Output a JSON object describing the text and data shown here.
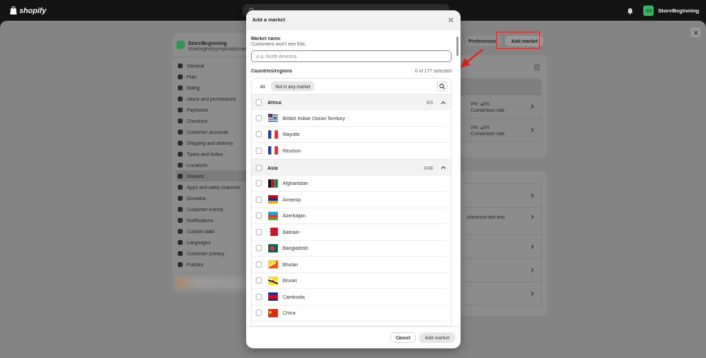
{
  "top_bar": {
    "logo": "shopify",
    "store_initials": "SB",
    "store_name": "StoreBeginning"
  },
  "settings": {
    "store_name": "StoreBeginning",
    "store_url": "storebeginning.myshopify.com",
    "nav": [
      {
        "label": "General",
        "selected": false
      },
      {
        "label": "Plan",
        "selected": false
      },
      {
        "label": "Billing",
        "selected": false
      },
      {
        "label": "Users and permissions",
        "selected": false
      },
      {
        "label": "Payments",
        "selected": false
      },
      {
        "label": "Checkout",
        "selected": false
      },
      {
        "label": "Customer accounts",
        "selected": false
      },
      {
        "label": "Shipping and delivery",
        "selected": false
      },
      {
        "label": "Taxes and duties",
        "selected": false
      },
      {
        "label": "Locations",
        "selected": false
      },
      {
        "label": "Markets",
        "selected": true
      },
      {
        "label": "Apps and sales channels",
        "selected": false
      },
      {
        "label": "Domains",
        "selected": false
      },
      {
        "label": "Customer events",
        "selected": false
      },
      {
        "label": "Notifications",
        "selected": false
      },
      {
        "label": "Custom data",
        "selected": false
      },
      {
        "label": "Languages",
        "selected": false
      },
      {
        "label": "Customer privacy",
        "selected": false
      },
      {
        "label": "Policies",
        "selected": false
      }
    ],
    "header_buttons": [
      {
        "label": "Preferences",
        "highlighted": false
      },
      {
        "label": "Add market",
        "highlighted": true
      }
    ],
    "stats": [
      {
        "value": "0%",
        "change": "▴0%",
        "label": "Conversion rate"
      },
      {
        "value": "0%",
        "change": "▴0%",
        "label": "Conversion rate"
      }
    ],
    "card_rows": [
      {
        "text": ""
      },
      {
        "text": "checkout fast and"
      },
      {
        "text": ""
      },
      {
        "text": ""
      },
      {
        "text": ""
      }
    ]
  },
  "modal": {
    "title": "Add a market",
    "name_label": "Market name",
    "name_hint": "Customers won't see this.",
    "name_field": {
      "placeholder": "e.g. North America"
    },
    "countries_label": "Countries/regions",
    "selected_count": "0 of 177 selected",
    "filters": [
      {
        "label": "All",
        "selected": false
      },
      {
        "label": "Not in any market",
        "selected": true
      }
    ],
    "groups": [
      {
        "name": "Africa",
        "count": "0/3",
        "checked": false,
        "expanded": true,
        "children": [
          {
            "name": "British Indian Ocean Territory",
            "checked": false
          },
          {
            "name": "Mayotte",
            "checked": false
          },
          {
            "name": "Réunion",
            "checked": false
          }
        ]
      },
      {
        "name": "Asia",
        "count": "0/48",
        "checked": false,
        "expanded": true,
        "children": [
          {
            "name": "Afghanistan",
            "checked": false
          },
          {
            "name": "Armenia",
            "checked": false
          },
          {
            "name": "Azerbaijan",
            "checked": false
          },
          {
            "name": "Bahrain",
            "checked": false
          },
          {
            "name": "Bangladesh",
            "checked": false
          },
          {
            "name": "Bhutan",
            "checked": false
          },
          {
            "name": "Brunei",
            "checked": false
          },
          {
            "name": "Cambodia",
            "checked": false
          },
          {
            "name": "China",
            "checked": false
          }
        ]
      }
    ],
    "buttons": [
      {
        "label": "Cancel",
        "disabled": false
      },
      {
        "label": "Add market",
        "disabled": true
      }
    ]
  }
}
